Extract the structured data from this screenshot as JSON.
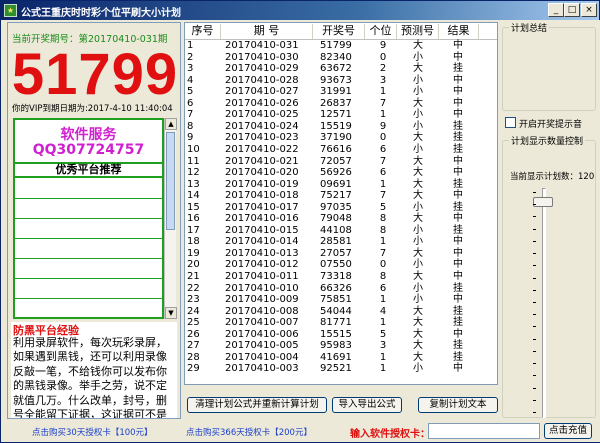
{
  "window": {
    "title": "公式王重庆时时彩个位平刷大小计划",
    "btn_min": "_",
    "btn_max": "□",
    "btn_close": "×"
  },
  "left": {
    "period_label": "当前开奖期号：",
    "period_value": "第20170410-031期",
    "big_number": "51799",
    "vip_expiry": "你的VIP到期日期为:2017-4-10 11:40:04",
    "ad": {
      "service": "软件服务",
      "qq": "QQ307724757",
      "recommend": "优秀平台推荐"
    },
    "warning": {
      "title": "防黑平台经验",
      "text": "利用录屏软件，每次玩彩录屏，如果遇到黑钱，还可以利用录像反敲一笔，不给钱你可以发布你的黑钱录像。举手之劳，说不定就值几万。什么改单，封号，删号全能留下证据，这证据可不是一百万能买的"
    }
  },
  "table": {
    "headers": [
      "序号",
      "期 号",
      "开奖号",
      "个位",
      "预测号",
      "结果"
    ],
    "rows": [
      [
        "1",
        "20170410-031",
        "51799",
        "9",
        "大",
        "中"
      ],
      [
        "2",
        "20170410-030",
        "82340",
        "0",
        "小",
        "中"
      ],
      [
        "3",
        "20170410-029",
        "63672",
        "2",
        "大",
        "挂"
      ],
      [
        "4",
        "20170410-028",
        "93673",
        "3",
        "小",
        "中"
      ],
      [
        "5",
        "20170410-027",
        "31991",
        "1",
        "小",
        "中"
      ],
      [
        "6",
        "20170410-026",
        "26837",
        "7",
        "大",
        "中"
      ],
      [
        "7",
        "20170410-025",
        "12571",
        "1",
        "小",
        "中"
      ],
      [
        "8",
        "20170410-024",
        "15519",
        "9",
        "小",
        "挂"
      ],
      [
        "9",
        "20170410-023",
        "37190",
        "0",
        "大",
        "挂"
      ],
      [
        "10",
        "20170410-022",
        "76616",
        "6",
        "小",
        "挂"
      ],
      [
        "11",
        "20170410-021",
        "72057",
        "7",
        "大",
        "中"
      ],
      [
        "12",
        "20170410-020",
        "56926",
        "6",
        "大",
        "中"
      ],
      [
        "13",
        "20170410-019",
        "09691",
        "1",
        "大",
        "挂"
      ],
      [
        "14",
        "20170410-018",
        "75217",
        "7",
        "大",
        "中"
      ],
      [
        "15",
        "20170410-017",
        "97035",
        "5",
        "小",
        "挂"
      ],
      [
        "16",
        "20170410-016",
        "79048",
        "8",
        "大",
        "中"
      ],
      [
        "17",
        "20170410-015",
        "44108",
        "8",
        "小",
        "挂"
      ],
      [
        "18",
        "20170410-014",
        "28581",
        "1",
        "小",
        "中"
      ],
      [
        "19",
        "20170410-013",
        "27057",
        "7",
        "大",
        "中"
      ],
      [
        "20",
        "20170410-012",
        "07550",
        "0",
        "小",
        "中"
      ],
      [
        "21",
        "20170410-011",
        "73318",
        "8",
        "大",
        "中"
      ],
      [
        "22",
        "20170410-010",
        "66326",
        "6",
        "小",
        "挂"
      ],
      [
        "23",
        "20170410-009",
        "75851",
        "1",
        "小",
        "中"
      ],
      [
        "24",
        "20170410-008",
        "54044",
        "4",
        "大",
        "挂"
      ],
      [
        "25",
        "20170410-007",
        "81771",
        "1",
        "大",
        "挂"
      ],
      [
        "26",
        "20170410-006",
        "15515",
        "5",
        "大",
        "中"
      ],
      [
        "27",
        "20170410-005",
        "95983",
        "3",
        "大",
        "挂"
      ],
      [
        "28",
        "20170410-004",
        "41691",
        "1",
        "大",
        "挂"
      ],
      [
        "29",
        "20170410-003",
        "92521",
        "1",
        "小",
        "中"
      ]
    ]
  },
  "buttons": {
    "clear": "清理计划公式并重新计算计划",
    "export": "导入导出公式",
    "copy": "复制计划文本",
    "buy": "点击充值"
  },
  "right": {
    "summary_title": "计划总结",
    "alert_label": "开启开奖提示音",
    "alert_checked": false,
    "control_title": "计划显示数量控制",
    "count_label": "当前显示计划数：",
    "count_value": "120",
    "slider_fraction": 0.06
  },
  "footer": {
    "link30": "点击购买30天授权卡【100元】",
    "link366": "点击购买366天授权卡【200元】",
    "card_label": "输入软件授权卡：",
    "card_value": ""
  }
}
